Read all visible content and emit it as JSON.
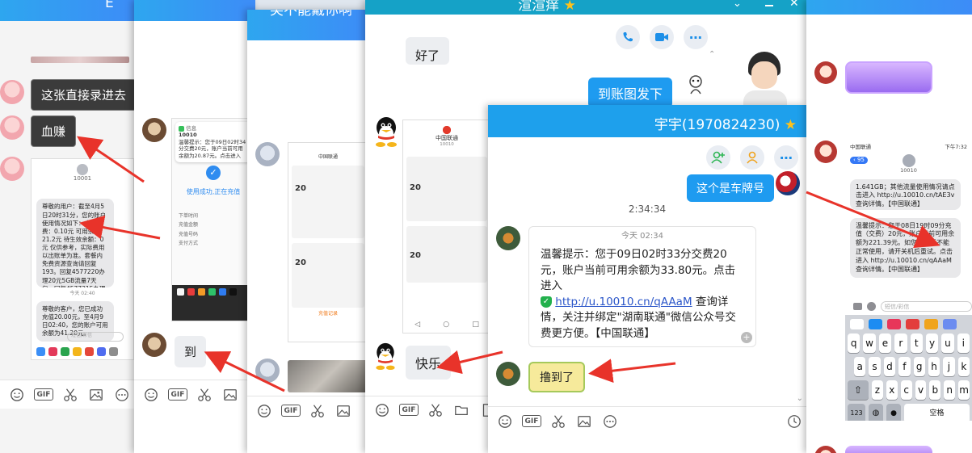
{
  "windows": {
    "w1": {
      "title": "E"
    },
    "w3": {
      "title": "笑不能戴你啊"
    },
    "w4": {
      "title": "渲渲痒",
      "menu_icon": "more-icon"
    },
    "w5": {
      "title": "宇宇(1970824230)"
    }
  },
  "w1": {
    "msg_1": "这张直接录进去",
    "msg_2": "血赚",
    "sms_header": "10001",
    "sms_1": "尊敬的用户：截至4月5日20时31分，您的账户使用情况如下：本月消费：0.10元 可用余额：21.2元 待生效余额：0元 仅供参考，实际费用以出账单为准。套餐内免费资源查询请回复193。回复4577220办理20元5GB流量7天包，回复4577315办理15元3GB假日3天包，流量使用详情可回复108查询。",
    "sms_time": "今天 02:40",
    "sms_2": "尊敬的客户，您已成功充值20.00元，至4月9日02:40，您的账户可用余额为41.20元。",
    "sms_input": "短信/彩信"
  },
  "w2": {
    "notif_app": "信息",
    "notif_sender": "10010",
    "notif_text": "温馨提示：您于09日02时34分交费20元，账户当前可用余额为20.87元。点击进入",
    "success_text": "使用成功,正在充值",
    "rows": [
      "下单时间",
      "充值金额",
      "充值号码",
      "支付方式"
    ],
    "msg_dao": "到"
  },
  "w3": {
    "shot_title": "中国联通",
    "amount_1": "20",
    "amount_2": "20",
    "pay_btn": "充值记录"
  },
  "w4": {
    "msg_partial": "好了",
    "msg_send": "到账图发下",
    "shot_title": "中国联通",
    "shot_sub": "10010",
    "amount_1": "20",
    "amount_2": "20",
    "msg_happy": "快乐"
  },
  "w5": {
    "msg_plate": "这个是车牌号",
    "time": "2:34:34",
    "card_time": "今天 02:34",
    "card_text_1": "温馨提示：您于09日02时33分交费20元，账户当前可用余额为33.80元。点击进入",
    "card_link": "http://u.10010.cn/qAAaM",
    "card_text_2": "查询详情，关注并绑定\"湖南联通\"微信公众号交费更方便。【中国联通】",
    "msg_got": "撸到了"
  },
  "w6": {
    "status_carrier": "中国联通",
    "status_time": "下午7:32",
    "back_count": "95",
    "sender": "10010",
    "sms_1": "1.641GB；其他流量使用情况请点击进入 http://u.10010.cn/tAE3v 查询详情。【中国联通】",
    "sms_2": "温馨提示：您于08日19时09分充值（交费）20元，账户当前可用余额为221.39元。如您交费后不能正常使用，请开关机后重试。点击进入 http://u.10010.cn/qAAaM 查询详情。【中国联通】",
    "input_placeholder": "短信/彩信",
    "keyboard_row1": [
      "q",
      "w",
      "e",
      "r",
      "t",
      "y",
      "u",
      "i"
    ],
    "keyboard_row2": [
      "a",
      "s",
      "d",
      "f",
      "g",
      "h",
      "j",
      "k"
    ],
    "keyboard_row3": [
      "z",
      "x",
      "c",
      "v",
      "b",
      "n",
      "m"
    ],
    "key_123": "123",
    "key_space": "空格"
  },
  "toolbar": {
    "gif": "GIF"
  },
  "colors": {
    "title_bar": "#3d8cf7",
    "bubble_blue": "#1e9bf0",
    "arrow": "#e8332a",
    "star": "#ffc21a"
  }
}
